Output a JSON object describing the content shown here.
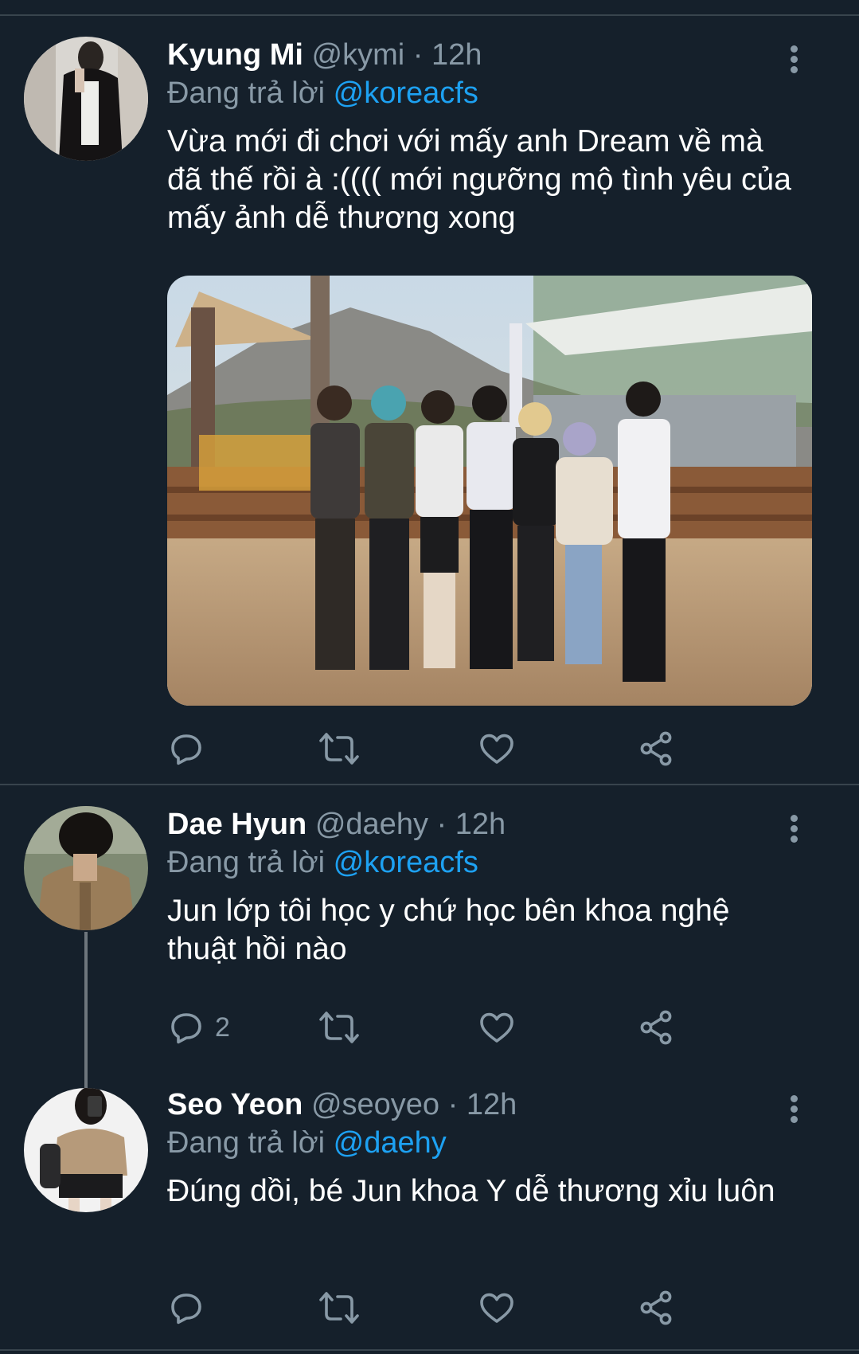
{
  "tweets": [
    {
      "name": "Kyung Mi",
      "handle": "@kymi",
      "time": "12h",
      "replying_label": "Đang trả lời",
      "replying_to": "@koreacfs",
      "text": "Vừa mới đi chơi với mấy anh Dream về mà đã thế rồi à :(((( mới ngưỡng mộ tình yêu của mấy ảnh dễ thương xong",
      "reply_count": ""
    },
    {
      "name": "Dae Hyun",
      "handle": "@daehy",
      "time": "12h",
      "replying_label": "Đang trả lời",
      "replying_to": "@koreacfs",
      "text": "Jun lớp tôi học y chứ học bên khoa nghệ thuật hồi nào",
      "reply_count": "2"
    },
    {
      "name": "Seo Yeon",
      "handle": "@seoyeo",
      "time": "12h",
      "replying_label": "Đang trả lời",
      "replying_to": "@daehy",
      "text": "Đúng dồi, bé Jun khoa Y dễ thương xỉu luôn",
      "reply_count": ""
    }
  ],
  "separator": "·",
  "icons": [
    "more-vertical-icon",
    "reply-icon",
    "retweet-icon",
    "like-icon",
    "share-icon"
  ],
  "colors": {
    "background": "#15202b",
    "divider": "#38444d",
    "secondary_text": "#8899a6",
    "mention": "#1da1f2"
  }
}
